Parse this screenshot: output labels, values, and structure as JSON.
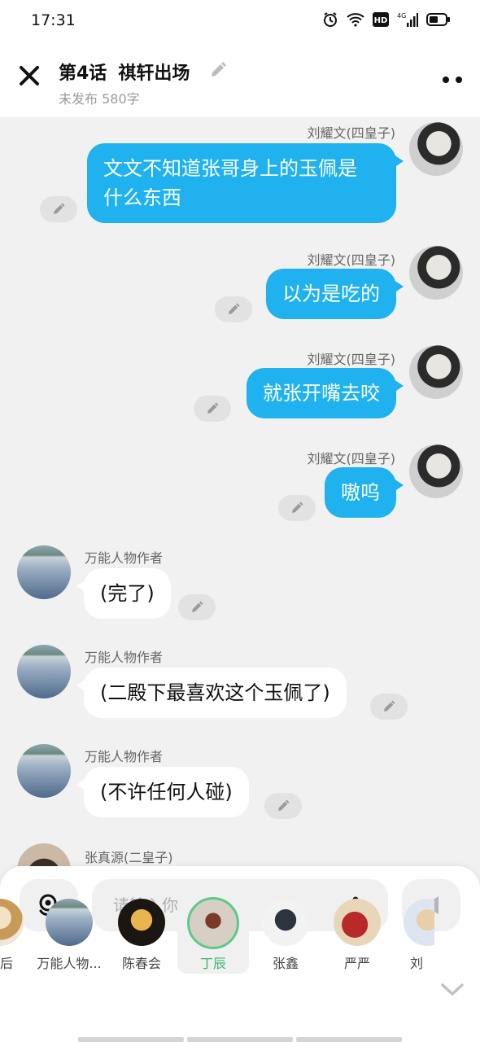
{
  "status": {
    "time": "17:31",
    "network": "4G"
  },
  "header": {
    "chapter": "第4话",
    "title": "祺轩出场",
    "meta": "未发布 580字"
  },
  "messages": [
    {
      "side": "right",
      "sender": "刘耀文(四皇子)",
      "lines": [
        "文文不知道张哥身上的玉佩是",
        "什么东西"
      ]
    },
    {
      "side": "right",
      "sender": "刘耀文(四皇子)",
      "lines": [
        "以为是吃的"
      ]
    },
    {
      "side": "right",
      "sender": "刘耀文(四皇子)",
      "lines": [
        "就张开嘴去咬"
      ]
    },
    {
      "side": "right",
      "sender": "刘耀文(四皇子)",
      "lines": [
        "嗷呜"
      ]
    },
    {
      "side": "left",
      "sender": "万能人物作者",
      "lines": [
        "(完了)"
      ]
    },
    {
      "side": "left",
      "sender": "万能人物作者",
      "lines": [
        "(二殿下最喜欢这个玉佩了)"
      ]
    },
    {
      "side": "left",
      "sender": "万能人物作者",
      "lines": [
        "(不许任何人碰)"
      ]
    },
    {
      "side": "left",
      "sender": "张真源(二皇子)",
      "lines": []
    }
  ],
  "input": {
    "placeholder": "请输入你的脑洞~"
  },
  "characters": [
    {
      "name": "皇后",
      "selected": false
    },
    {
      "name": "万能人物...",
      "selected": false
    },
    {
      "name": "陈春会",
      "selected": false
    },
    {
      "name": "丁辰",
      "selected": true
    },
    {
      "name": "张鑫",
      "selected": false
    },
    {
      "name": "严严",
      "selected": false
    },
    {
      "name": "刘",
      "selected": false
    }
  ],
  "colors": {
    "my_bubble": "#1fb2ee",
    "selected_char": "#3bb46e"
  }
}
